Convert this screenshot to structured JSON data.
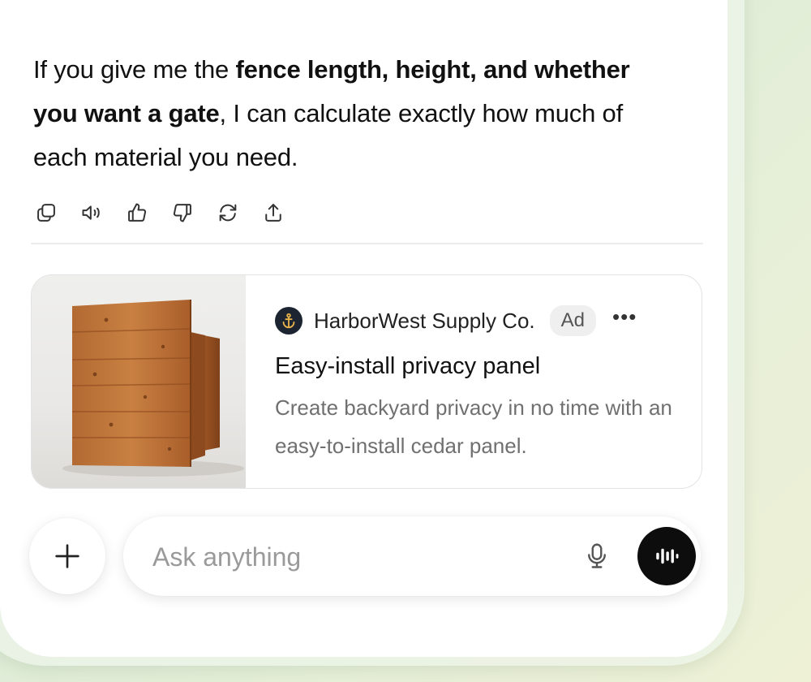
{
  "message": {
    "text_1": "If you give me the ",
    "bold_1": "fence length, height, and whether you want a gate",
    "text_2": ", I can calculate exactly how much of each material you need."
  },
  "actions": [
    {
      "icon": "copy-icon"
    },
    {
      "icon": "read-aloud-icon"
    },
    {
      "icon": "thumbs-up-icon"
    },
    {
      "icon": "thumbs-down-icon"
    },
    {
      "icon": "regenerate-icon"
    },
    {
      "icon": "share-icon"
    }
  ],
  "ad": {
    "advertiser": "HarborWest Supply Co.",
    "badge": "Ad",
    "more_label": "•••",
    "title": "Easy-install privacy panel",
    "description": "Create backyard privacy in no time with an easy-to-install cedar panel.",
    "logo_icon": "anchor-icon",
    "image_subject": "cedar-panel-product-image"
  },
  "composer": {
    "placeholder": "Ask anything",
    "value": "",
    "plus_icon": "plus-icon",
    "mic_icon": "microphone-icon",
    "voice_icon": "voice-waveform-icon"
  },
  "colors": {
    "background_start": "#cfe4d0",
    "background_end": "#eef1d6",
    "screen": "#ffffff",
    "text": "#111111",
    "muted_text": "#707070",
    "ad_badge_bg": "#efefef",
    "voice_button": "#0d0d0d",
    "logo_bg": "#1c2431",
    "logo_fg": "#e7b34a"
  }
}
